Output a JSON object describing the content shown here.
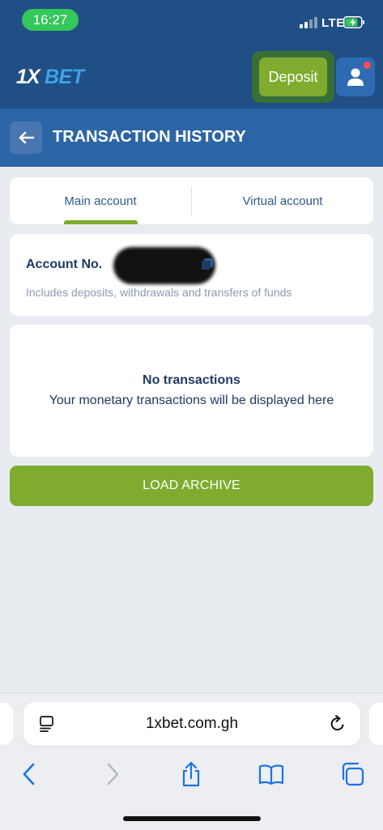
{
  "status_bar": {
    "time": "16:27",
    "network": "LTE"
  },
  "header": {
    "deposit_label": "Deposit"
  },
  "page": {
    "title": "TRANSACTION HISTORY"
  },
  "tabs": [
    {
      "label": "Main account",
      "active": true
    },
    {
      "label": "Virtual account",
      "active": false
    }
  ],
  "account": {
    "label": "Account No.",
    "description": "Includes deposits, withdrawals and transfers of funds"
  },
  "empty_state": {
    "title": "No transactions",
    "description": "Your monetary transactions will be displayed here"
  },
  "load_archive_label": "LOAD ARCHIVE",
  "browser": {
    "url": "1xbet.com.gh"
  },
  "colors": {
    "header": "#1f4f84",
    "title_bar": "#2c65a5",
    "accent_green": "#7fac2f",
    "text_dark": "#1d3b63"
  },
  "icons": [
    "back-arrow-icon",
    "user-icon",
    "copy-icon",
    "reader-icon",
    "reload-icon",
    "browser-back-icon",
    "browser-forward-icon",
    "share-icon",
    "bookmarks-icon",
    "tabs-icon"
  ]
}
